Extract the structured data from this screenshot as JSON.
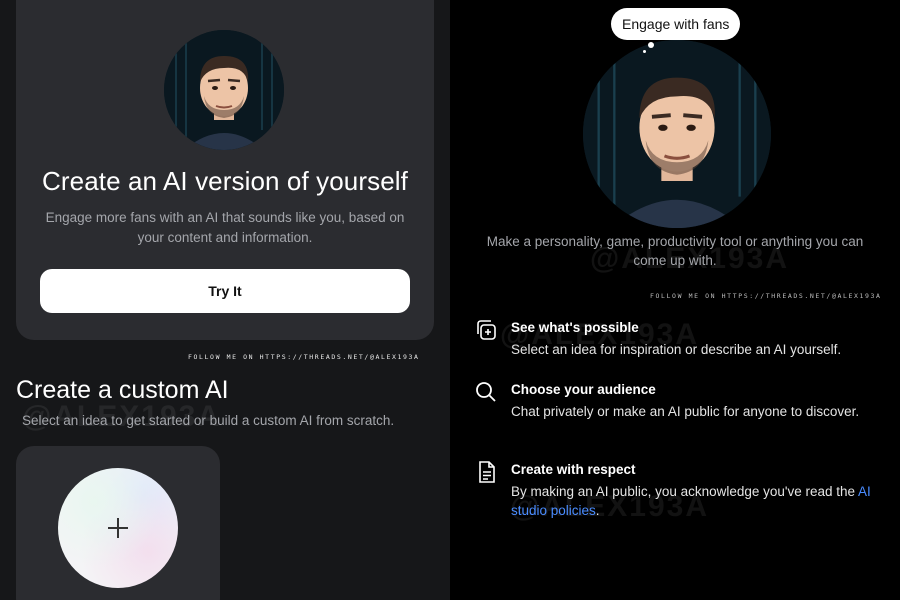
{
  "left_pane": {
    "ai_card": {
      "title": "Create an AI version of yourself",
      "description": "Engage more fans with an AI that sounds like you, based on your content and information.",
      "button_label": "Try It"
    },
    "watermark": "FOLLOW ME ON HTTPS://THREADS.NET/@ALEX193A",
    "custom_section": {
      "title": "Create a custom AI",
      "description": "Select an idea to get started or build a custom AI from scratch."
    }
  },
  "right_pane": {
    "bubble_text": "Engage with fans",
    "description": "Make a personality, game, productivity tool or anything you can come up with.",
    "watermark": "FOLLOW ME ON HTTPS://THREADS.NET/@ALEX193A",
    "features": [
      {
        "icon": "add-copy-icon",
        "title": "See what's possible",
        "description": "Select an idea for inspiration or describe an AI yourself."
      },
      {
        "icon": "search-icon",
        "title": "Choose your audience",
        "description": "Chat privately or make an AI public for anyone to discover."
      },
      {
        "icon": "document-icon",
        "title": "Create with respect",
        "description_prefix": "By making an AI public, you acknowledge you've read the ",
        "link_text": "AI studio policies",
        "description_suffix": "."
      }
    ]
  },
  "background_watermark": "@ALEX193A",
  "colors": {
    "left_background": "#161719",
    "card_background": "#2b2c30",
    "right_background": "#000000",
    "link": "#4a8cff"
  }
}
